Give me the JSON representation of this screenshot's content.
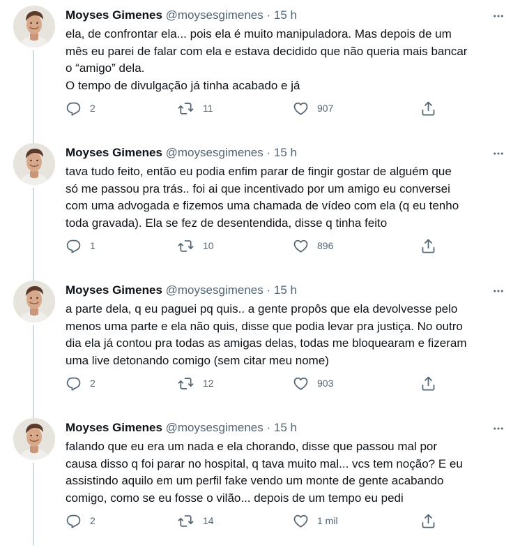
{
  "tweets": [
    {
      "name": "Moyses Gimenes",
      "handle": "@moysesgimenes",
      "separator": "·",
      "time": "15 h",
      "lines": [
        "ela, de confrontar ela... pois ela é muito manipuladora. Mas depois de um",
        "mês eu parei de falar com ela e estava decidido que não queria mais bancar",
        "o “amigo” dela.",
        "O tempo de divulgação já tinha acabado e já"
      ],
      "replies": "2",
      "retweets": "11",
      "likes": "907"
    },
    {
      "name": "Moyses Gimenes",
      "handle": "@moysesgimenes",
      "separator": "·",
      "time": "15 h",
      "lines": [
        "tava tudo feito, então eu podia enfim parar de fingir gostar de alguém que",
        "só me passou pra trás.. foi ai que incentivado por um amigo eu conversei",
        "com uma advogada e fizemos uma chamada de vídeo com ela (q eu tenho",
        "toda gravada). Ela se fez de desentendida, disse q tinha feito"
      ],
      "replies": "1",
      "retweets": "10",
      "likes": "896"
    },
    {
      "name": "Moyses Gimenes",
      "handle": "@moysesgimenes",
      "separator": "·",
      "time": "15 h",
      "lines": [
        "a parte dela, q eu paguei pq quis.. a gente propôs que ela devolvesse pelo",
        "menos uma parte e ela não quis, disse que podia levar pra justiça. No outro",
        "dia ela já contou pra todas as amigas delas, todas me bloquearam e fizeram",
        "uma live detonando comigo (sem citar meu nome)"
      ],
      "replies": "2",
      "retweets": "12",
      "likes": "903"
    },
    {
      "name": "Moyses Gimenes",
      "handle": "@moysesgimenes",
      "separator": "·",
      "time": "15 h",
      "lines": [
        "falando que eu era um nada e ela chorando, disse que passou mal por",
        "causa disso q foi parar no hospital, q tava muito mal... vcs tem noção?  E eu",
        "assistindo aquilo em um perfil fake vendo um monte de gente acabando",
        "comigo, como se eu fosse o vilão... depois de um tempo eu pedi"
      ],
      "replies": "2",
      "retweets": "14",
      "likes": "1 mil"
    }
  ],
  "icons": {
    "more": "more-horizontal-icon",
    "reply": "reply-bubble-icon",
    "retweet": "retweet-arrows-icon",
    "like": "heart-icon",
    "share": "share-upload-icon"
  },
  "colors": {
    "text": "#0f1419",
    "secondary": "#536471",
    "thread_line": "#cfd9de",
    "background": "#ffffff"
  }
}
